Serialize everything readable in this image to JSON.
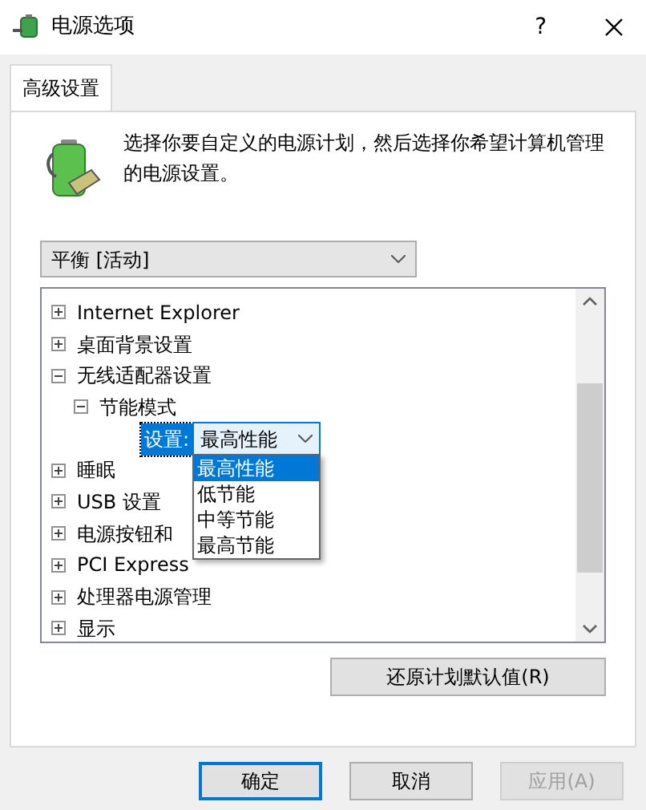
{
  "window": {
    "title": "电源选项",
    "help": "?"
  },
  "tabs": [
    {
      "label": "高级设置",
      "selected": true
    }
  ],
  "intro": "选择你要自定义的电源计划，然后选择你希望计算机管理的电源设置。",
  "plan": {
    "value": "平衡 [活动]"
  },
  "tree": [
    {
      "label": "Internet Explorer",
      "expanded": false
    },
    {
      "label": "桌面背景设置",
      "expanded": false
    },
    {
      "label": "无线适配器设置",
      "expanded": true,
      "children": [
        {
          "label": "节能模式",
          "expanded": true,
          "children": [
            {
              "kind": "setting",
              "label": "设置:",
              "value": "最高性能",
              "selected": true,
              "options": [
                {
                  "label": "最高性能",
                  "selected": true
                },
                {
                  "label": "低节能",
                  "selected": false
                },
                {
                  "label": "中等节能",
                  "selected": false
                },
                {
                  "label": "最高节能",
                  "selected": false
                }
              ]
            }
          ]
        }
      ]
    },
    {
      "label": "睡眠",
      "expanded": false
    },
    {
      "label": "USB 设置",
      "expanded": false
    },
    {
      "label": "电源按钮和",
      "expanded": false
    },
    {
      "label": "PCI Express",
      "expanded": false
    },
    {
      "label": "处理器电源管理",
      "expanded": false
    },
    {
      "label": "显示",
      "expanded": false
    }
  ],
  "restore_button": "还原计划默认值(R)",
  "buttons": [
    {
      "label": "确定",
      "default": true,
      "disabled": false
    },
    {
      "label": "取消",
      "default": false,
      "disabled": false
    },
    {
      "label": "应用(A)",
      "default": false,
      "disabled": true
    }
  ]
}
